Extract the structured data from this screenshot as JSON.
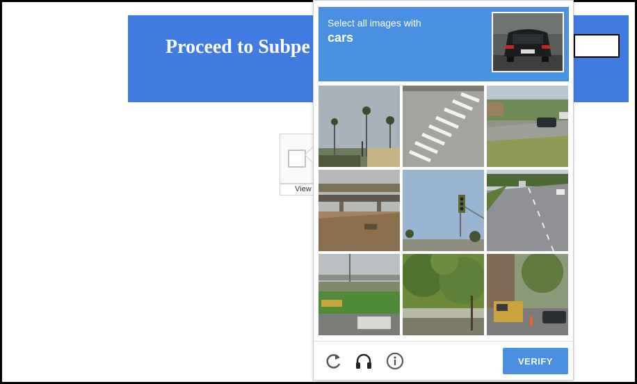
{
  "page": {
    "banner_title": "Proceed to Subpe",
    "view_tab_label": "View"
  },
  "challenge": {
    "instruction": "Select all images with",
    "keyword": "cars",
    "example_image": "car-rear-view",
    "tiles": [
      {
        "scene": "palm-trees-street"
      },
      {
        "scene": "crosswalk"
      },
      {
        "scene": "road-with-car"
      },
      {
        "scene": "bridge-dry-brush"
      },
      {
        "scene": "traffic-light"
      },
      {
        "scene": "highway"
      },
      {
        "scene": "overpass-field"
      },
      {
        "scene": "trees-fence"
      },
      {
        "scene": "city-street-truck"
      }
    ],
    "footer": {
      "reload_icon": "reload-icon",
      "audio_icon": "headphones-icon",
      "info_icon": "info-icon",
      "verify_label": "VERIFY"
    }
  },
  "colors": {
    "banner": "#3f7be1",
    "header": "#4a90e2",
    "verify": "#4a90e2"
  }
}
